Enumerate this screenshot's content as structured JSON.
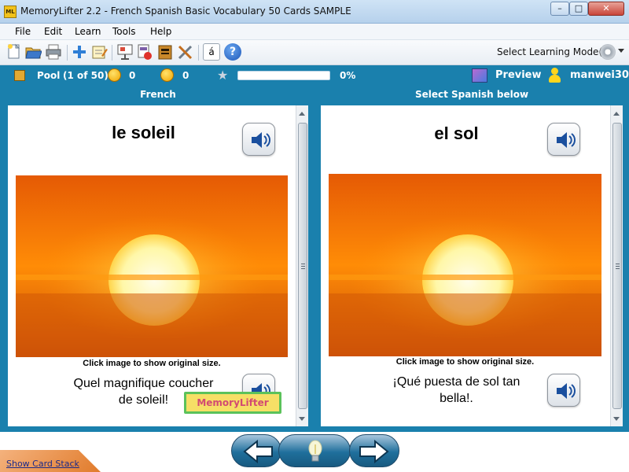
{
  "window": {
    "title": "MemoryLifter 2.2 - French Spanish Basic Vocabulary 50 Cards SAMPLE",
    "app_icon_text": "ML",
    "controls": {
      "minimize": "–",
      "maximize": "□",
      "close": "✕"
    }
  },
  "menu": {
    "items": [
      "File",
      "Edit",
      "Learn",
      "Tools",
      "Help"
    ]
  },
  "toolbar": {
    "buttons": [
      "new-document",
      "open-folder",
      "print",
      "add-card",
      "edit-card",
      "presentation",
      "print-cards",
      "dictionary",
      "tools-settings",
      "special-characters",
      "help"
    ],
    "special_char_label": "á",
    "help_label": "?",
    "mode_label": "Select Learning Mode(s)"
  },
  "status": {
    "pool_label": "Pool",
    "pool_count": "(1 of 50)",
    "correct_count": "0",
    "wrong_count": "0",
    "progress_percent": 0,
    "progress_label": "0%",
    "preview_label": "Preview",
    "username": "manwei30"
  },
  "question_panel": {
    "header": "French",
    "word": "le soleil",
    "caption": "Click image to show original size.",
    "sentence_line1": "Quel magnifique coucher",
    "sentence_line2": "de soleil!",
    "logo_text": "MemoryLifter"
  },
  "answer_panel": {
    "header": "Select Spanish below",
    "word": "el sol",
    "caption": "Click image to show original size.",
    "sentence_line1": "¡Qué puesta de sol tan",
    "sentence_line2": "bella!."
  },
  "bottom": {
    "show_card_stack": "Show Card Stack"
  },
  "colors": {
    "accent_blue": "#1a80ad",
    "progress_green": "#5fc24a",
    "sun_orange": "#ff8a00"
  }
}
